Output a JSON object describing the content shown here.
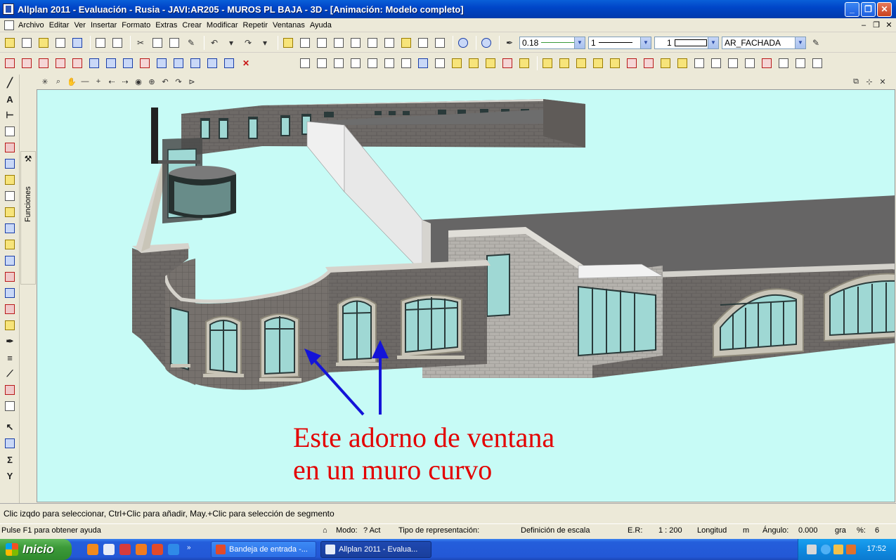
{
  "window": {
    "title": "Allplan 2011 - Evaluación - Rusia - JAVI:AR205 - MUROS PL BAJA - 3D - [Animación: Modelo completo]",
    "minimize": "_",
    "maximize": "❐",
    "close": "✕"
  },
  "menu": {
    "items": [
      "Archivo",
      "Editar",
      "Ver",
      "Insertar",
      "Formato",
      "Extras",
      "Crear",
      "Modificar",
      "Repetir",
      "Ventanas",
      "Ayuda"
    ],
    "mdi_minimize": "–",
    "mdi_restore": "❐",
    "mdi_close": "✕"
  },
  "toolbar": {
    "pen_thickness": "0.18",
    "line_type": "1",
    "line_color": "1",
    "layer": "AR_FACHADA"
  },
  "left_panel": {
    "funciones_label": "Funciones"
  },
  "viewport": {
    "annotation_line1": "Este adorno  de ventana",
    "annotation_line2": "en un muro curvo",
    "background": "#c7fbf6",
    "annotation_color": "#e30000",
    "arrow_color": "#1414d8"
  },
  "hint": "Clic izqdo para seleccionar, Ctrl+Clic para añadir, May.+Clic para selección de segmento",
  "status": {
    "help": "Pulse F1 para obtener ayuda",
    "mode_label": "Modo:",
    "mode_value": "? Act",
    "representation_label": "Tipo de representación:",
    "scale_def": "Definición de escala",
    "er_label": "E.R:",
    "er_value": "1 : 200",
    "length_label": "Longitud",
    "length_unit": "m",
    "angle_label": "Ángulo:",
    "angle_value": "0.000",
    "angle_unit": "gra",
    "percent_label": "%:",
    "percent_value": "6"
  },
  "taskbar": {
    "start_label": "Inicio",
    "tasks": [
      {
        "label": "Bandeja de entrada -..."
      },
      {
        "label": "Allplan 2011 - Evalua..."
      }
    ],
    "clock": "17:52"
  }
}
